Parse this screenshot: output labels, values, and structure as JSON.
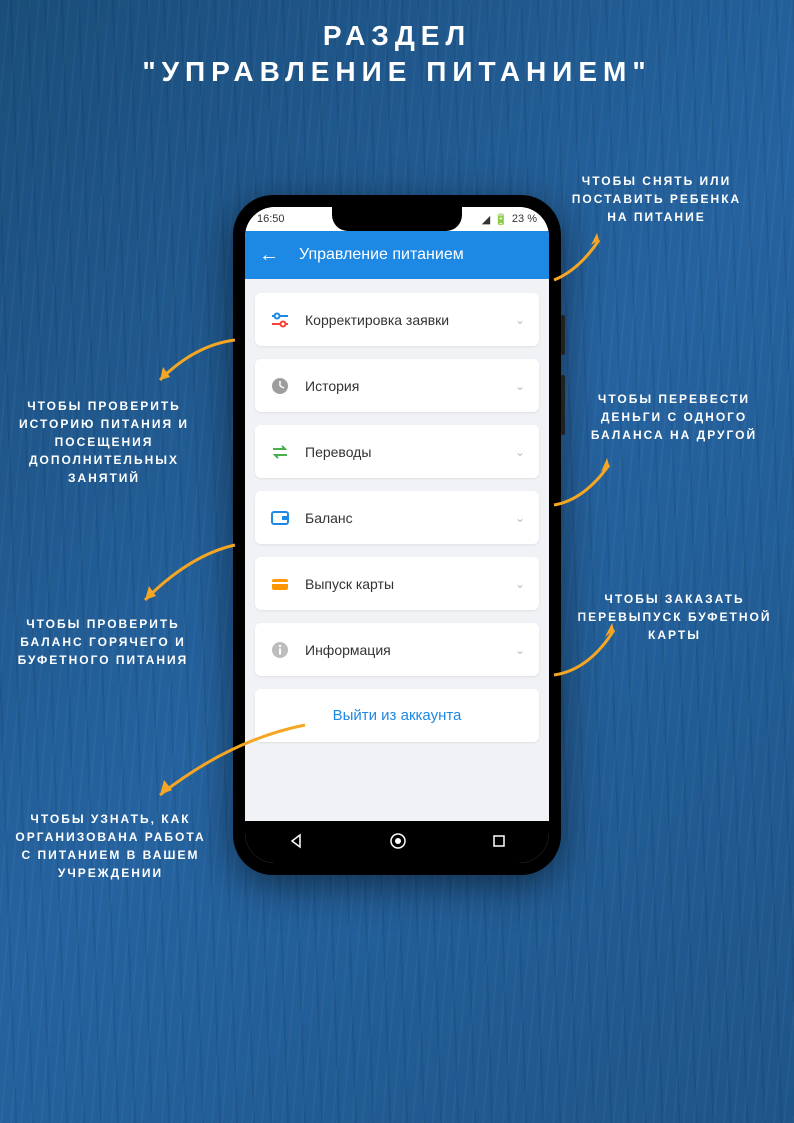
{
  "title": {
    "line1": "РАЗДЕЛ",
    "line2": "\"УПРАВЛЕНИЕ ПИТАНИЕМ\""
  },
  "status_bar": {
    "time": "16:50",
    "battery": "23 %"
  },
  "app_bar": {
    "title": "Управление питанием"
  },
  "menu": [
    {
      "label": "Корректировка заявки",
      "icon": "sliders",
      "color": "#1e88e5"
    },
    {
      "label": "История",
      "icon": "clock",
      "color": "#9e9e9e"
    },
    {
      "label": "Переводы",
      "icon": "transfer",
      "color": "#4caf50"
    },
    {
      "label": "Баланс",
      "icon": "wallet",
      "color": "#1e88e5"
    },
    {
      "label": "Выпуск карты",
      "icon": "card",
      "color": "#ff9800"
    },
    {
      "label": "Информация",
      "icon": "info",
      "color": "#bdbdbd"
    }
  ],
  "logout": "Выйти из аккаунта",
  "annotations": {
    "adjust": "ЧТОБЫ СНЯТЬ ИЛИ ПОСТАВИТЬ РЕБЕНКА НА ПИТАНИЕ",
    "history": "ЧТОБЫ ПРОВЕРИТЬ ИСТОРИЮ ПИТАНИЯ И ПОСЕЩЕНИЯ ДОПОЛНИТЕЛЬНЫХ ЗАНЯТИЙ",
    "transfers": "ЧТОБЫ ПЕРЕВЕСТИ ДЕНЬГИ С ОДНОГО БАЛАНСА НА ДРУГОЙ",
    "balance": "ЧТОБЫ ПРОВЕРИТЬ БАЛАНС ГОРЯЧЕГО И БУФЕТНОГО ПИТАНИЯ",
    "card": "ЧТОБЫ ЗАКАЗАТЬ ПЕРЕВЫПУСК БУФЕТНОЙ КАРТЫ",
    "info": "ЧТОБЫ УЗНАТЬ, КАК ОРГАНИЗОВАНА РАБОТА С ПИТАНИЕМ В ВАШЕМ УЧРЕЖДЕНИИ"
  }
}
